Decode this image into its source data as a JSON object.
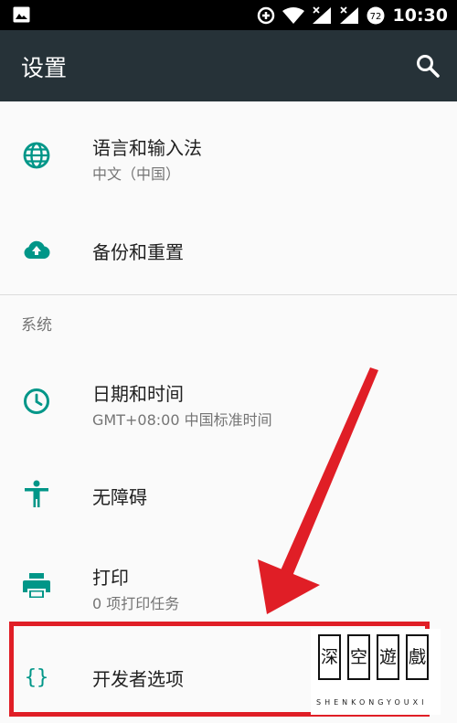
{
  "status_bar": {
    "time": "10:30",
    "battery_level": "72"
  },
  "app_bar": {
    "title": "设置"
  },
  "items": [
    {
      "primary": "语言和输入法",
      "secondary": "中文（中国）",
      "icon": "globe-icon"
    },
    {
      "primary": "备份和重置",
      "icon": "cloud-upload-icon"
    },
    {
      "primary": "日期和时间",
      "secondary": "GMT+08:00 中国标准时间",
      "icon": "clock-icon"
    },
    {
      "primary": "无障碍",
      "icon": "accessibility-icon"
    },
    {
      "primary": "打印",
      "secondary": "0 项打印任务",
      "icon": "printer-icon"
    },
    {
      "primary": "开发者选项",
      "icon": "curly-braces-icon"
    }
  ],
  "section_header": "系统",
  "watermark": {
    "chars": [
      "深",
      "空",
      "遊",
      "戲"
    ],
    "latin": "SHENKONGYOUXI"
  },
  "colors": {
    "accent": "#009688",
    "app_bar": "#263238",
    "highlight": "#e01e26"
  }
}
